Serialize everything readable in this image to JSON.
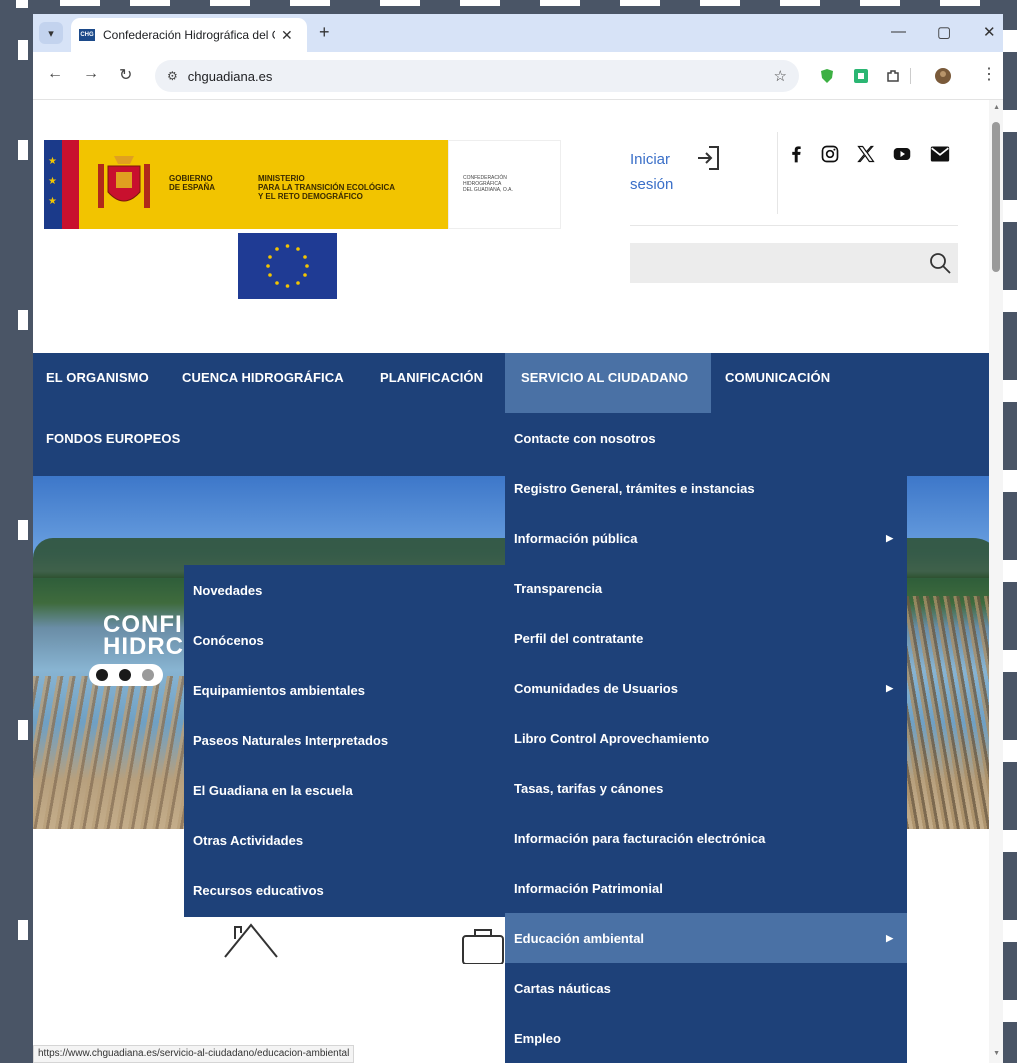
{
  "browser": {
    "tab_title": "Confederación Hidrográfica del Guadiana",
    "favicon_label": "CHG",
    "new_tab": "+",
    "url": "chguadiana.es",
    "status_url": "https://www.chguadiana.es/servicio-al-ciudadano/educacion-ambiental"
  },
  "header": {
    "gov_line1": "GOBIERNO",
    "gov_line2": "DE ESPAÑA",
    "ministry_line1": "MINISTERIO",
    "ministry_line2": "PARA LA TRANSICIÓN ECOLÓGICA",
    "ministry_line3": "Y EL RETO DEMOGRÁFICO",
    "chg_line1": "CONFEDERACIÓN",
    "chg_line2": "HIDROGRÁFICA",
    "chg_line3": "DEL GUADIANA, O.A.",
    "login_line1": "Iniciar",
    "login_line2": "sesión",
    "search_placeholder": ""
  },
  "nav": {
    "items": [
      "EL ORGANISMO",
      "CUENCA HIDROGRÁFICA",
      "PLANIFICACIÓN",
      "SERVICIO AL CIUDADANO",
      "COMUNICACIÓN",
      "FONDOS EUROPEOS"
    ],
    "active": "SERVICIO AL CIUDADANO"
  },
  "hero": {
    "title_line1": "CONFI",
    "title_line2": "HIDRC"
  },
  "servicio_menu": [
    {
      "label": "Contacte con nosotros",
      "has_sub": false
    },
    {
      "label": "Registro General, trámites e instancias",
      "has_sub": false
    },
    {
      "label": "Información pública",
      "has_sub": true
    },
    {
      "label": "Transparencia",
      "has_sub": false
    },
    {
      "label": "Perfil del contratante",
      "has_sub": false
    },
    {
      "label": "Comunidades de Usuarios",
      "has_sub": true
    },
    {
      "label": "Libro Control Aprovechamiento",
      "has_sub": false
    },
    {
      "label": "Tasas, tarifas y cánones",
      "has_sub": false
    },
    {
      "label": "Información para facturación electrónica",
      "has_sub": false
    },
    {
      "label": "Información Patrimonial",
      "has_sub": false
    },
    {
      "label": "Educación ambiental",
      "has_sub": true,
      "highlighted": true
    },
    {
      "label": "Cartas náuticas",
      "has_sub": false
    },
    {
      "label": "Empleo",
      "has_sub": false
    }
  ],
  "educacion_submenu": [
    "Novedades",
    "Conócenos",
    "Equipamientos ambientales",
    "Paseos Naturales Interpretados",
    "El Guadiana en la escuela",
    "Otras Actividades",
    "Recursos educativos"
  ],
  "colors": {
    "nav_bg": "#1e4179",
    "nav_active": "#4a71a5",
    "gov_yellow": "#f2c400",
    "link_blue": "#3a6fc8"
  }
}
